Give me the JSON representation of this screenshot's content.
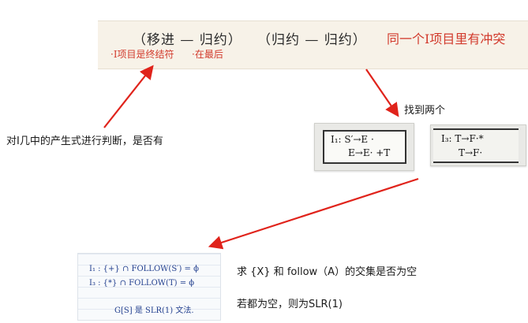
{
  "handwritten_header": {
    "shift_reduce": "（移进 — 归约）",
    "reduce_reduce": "（归约 — 归约）",
    "conflict_note": "同一个I项目里有冲突",
    "sub_note_1": "·I项目是终结符",
    "sub_note_2": "·在最后"
  },
  "notes": {
    "left": "对I几中的产生式进行判断，是否有",
    "found_two": "找到两个",
    "intersection": "求 {X} 和 follow（A）的交集是否为空",
    "conclusion": "若都为空，则为SLR(1)"
  },
  "item_set_1": {
    "line_1": "I₁: S′→E ·",
    "line_2": "E→E· +T"
  },
  "item_set_3": {
    "line_1": "I₃: T→F·*",
    "line_2": "T→F·"
  },
  "handwritten_check": {
    "line_1": "I₁ :  {+} ∩ FOLLOW(S′) = ϕ",
    "line_2": "I₃ :  {*} ∩ FOLLOW(T) = ϕ",
    "line_3": "G[S] 是 SLR(1) 文法."
  },
  "colors": {
    "arrow": "#e0231b",
    "handwriting_red": "#d23a2c",
    "handwriting_blue": "#23408f"
  }
}
